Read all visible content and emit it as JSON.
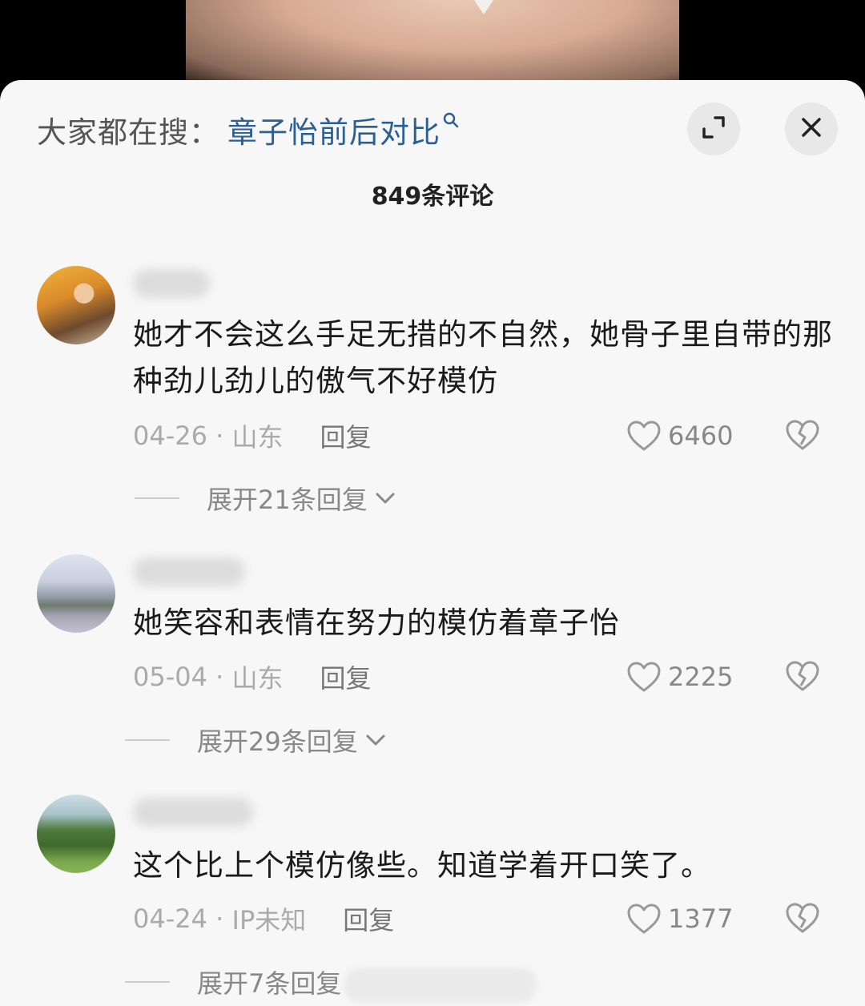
{
  "search_bar": {
    "prefix": "大家都在搜：",
    "term": "章子怡前后对比"
  },
  "icons": {
    "search": "search-icon",
    "expand": "expand-icon",
    "close": "close-icon",
    "like": "heart-icon",
    "dislike": "broken-heart-icon",
    "chevron": "chevron-down-icon"
  },
  "comment_count": "849条评论",
  "comments": [
    {
      "text": "她才不会这么手足无措的不自然，她骨子里自带的那种劲儿劲儿的傲气不好模仿",
      "date": "04-26",
      "location": "山东",
      "reply_label": "回复",
      "likes": "6460",
      "expand_label": "展开21条回复"
    },
    {
      "text": "她笑容和表情在努力的模仿着章子怡",
      "date": "05-04",
      "location": "山东",
      "reply_label": "回复",
      "likes": "2225",
      "expand_label": "展开29条回复"
    },
    {
      "text": "这个比上个模仿像些。知道学着开口笑了。",
      "date": "04-24",
      "location": "IP未知",
      "reply_label": "回复",
      "likes": "1377",
      "expand_label": "展开7条回复"
    }
  ],
  "colors": {
    "sheet_bg": "#f7f7f7",
    "search_term": "#2a5f96",
    "text": "#1a1a1a",
    "meta": "#aaaaaa"
  }
}
